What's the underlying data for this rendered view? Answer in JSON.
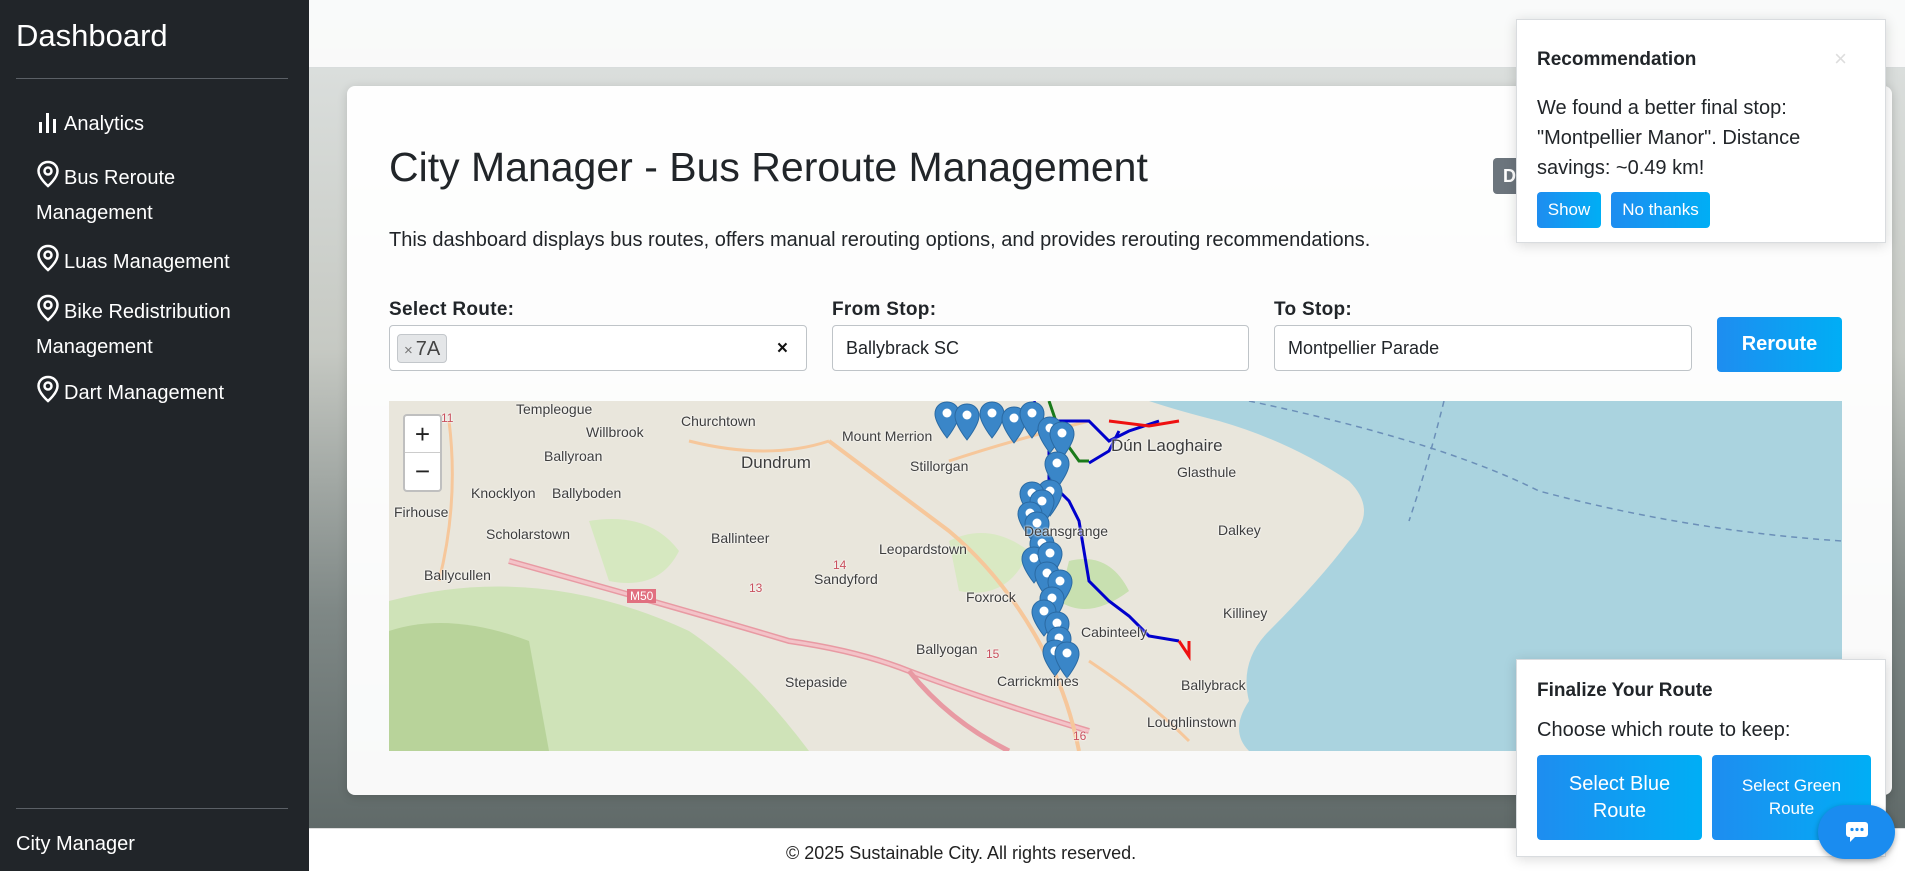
{
  "sidebar": {
    "title": "Dashboard",
    "items": [
      {
        "label": "Analytics",
        "icon": "bar-chart-icon"
      },
      {
        "label": "Bus Reroute Management",
        "icon": "map-pin-icon"
      },
      {
        "label": "Luas Management",
        "icon": "map-pin-icon"
      },
      {
        "label": "Bike Redistribution Management",
        "icon": "map-pin-icon"
      },
      {
        "label": "Dart Management",
        "icon": "map-pin-icon"
      }
    ],
    "footer_user": "City Manager"
  },
  "main": {
    "title": "City Manager - Bus Reroute Management",
    "description": "This dashboard displays bus routes, offers manual rerouting options, and provides rerouting recommendations.",
    "badge_text": "D",
    "form": {
      "route_label": "Select Route:",
      "route_selected": "7A",
      "from_label": "From Stop:",
      "from_value": "Ballybrack SC",
      "to_label": "To Stop:",
      "to_value": "Montpellier Parade",
      "reroute_button": "Reroute"
    },
    "map": {
      "zoom_in": "+",
      "zoom_out": "−",
      "places": [
        "Templeogue",
        "Churchtown",
        "Mount Merrion",
        "Dún Laoghaire",
        "Willbrook",
        "Ballyroan",
        "Dundrum",
        "Stillorgan",
        "Knocklyon",
        "Ballyboden",
        "Glasthule",
        "Firhouse",
        "Scholarstown",
        "Ballinteer",
        "Leopardstown",
        "Deansgrange",
        "Dalkey",
        "Ballycullen",
        "Sandyford",
        "Foxrock",
        "Killiney",
        "Cabinteely",
        "Ballyogan",
        "Stepaside",
        "Carrickmines",
        "Ballybrack",
        "Loughlinstown"
      ],
      "road_labels": [
        "M50",
        "14",
        "13",
        "15",
        "16",
        "11"
      ],
      "colors": {
        "blue_route": "#0000cc",
        "green_route": "#1a7a1a",
        "red_route": "#ee1111",
        "sea": "#aad3df",
        "marker": "#3a86c8"
      }
    }
  },
  "recommendation": {
    "title": "Recommendation",
    "close": "×",
    "body": "We found a better final stop: \"Montpellier Manor\". Distance savings: ~0.49 km!",
    "show_button": "Show",
    "no_button": "No thanks"
  },
  "finalize": {
    "title": "Finalize Your Route",
    "subtitle": "Choose which route to keep:",
    "blue_button": "Select Blue Route",
    "green_button": "Select Green Route"
  },
  "footer": {
    "text": "© 2025 Sustainable City. All rights reserved."
  },
  "chat": {
    "icon": "chat-icon"
  }
}
